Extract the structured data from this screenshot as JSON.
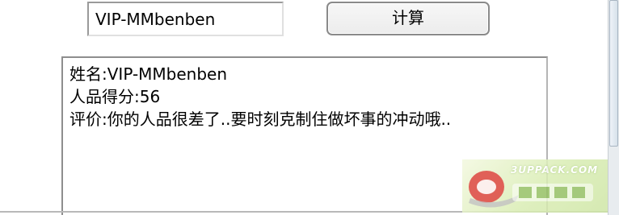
{
  "form": {
    "name_value": "VIP-MMbenben",
    "calc_button_label": "计算"
  },
  "result": {
    "lines": [
      "姓名:VIP-MMbenben",
      "人品得分:56",
      "评价:你的人品很差了..要时刻克制住做坏事的冲动哦.."
    ]
  },
  "watermark": {
    "url_text": "3UPPACK.COM"
  },
  "colors": {
    "watermark_red": "#d9322b",
    "watermark_green": "#cfe6a6"
  }
}
